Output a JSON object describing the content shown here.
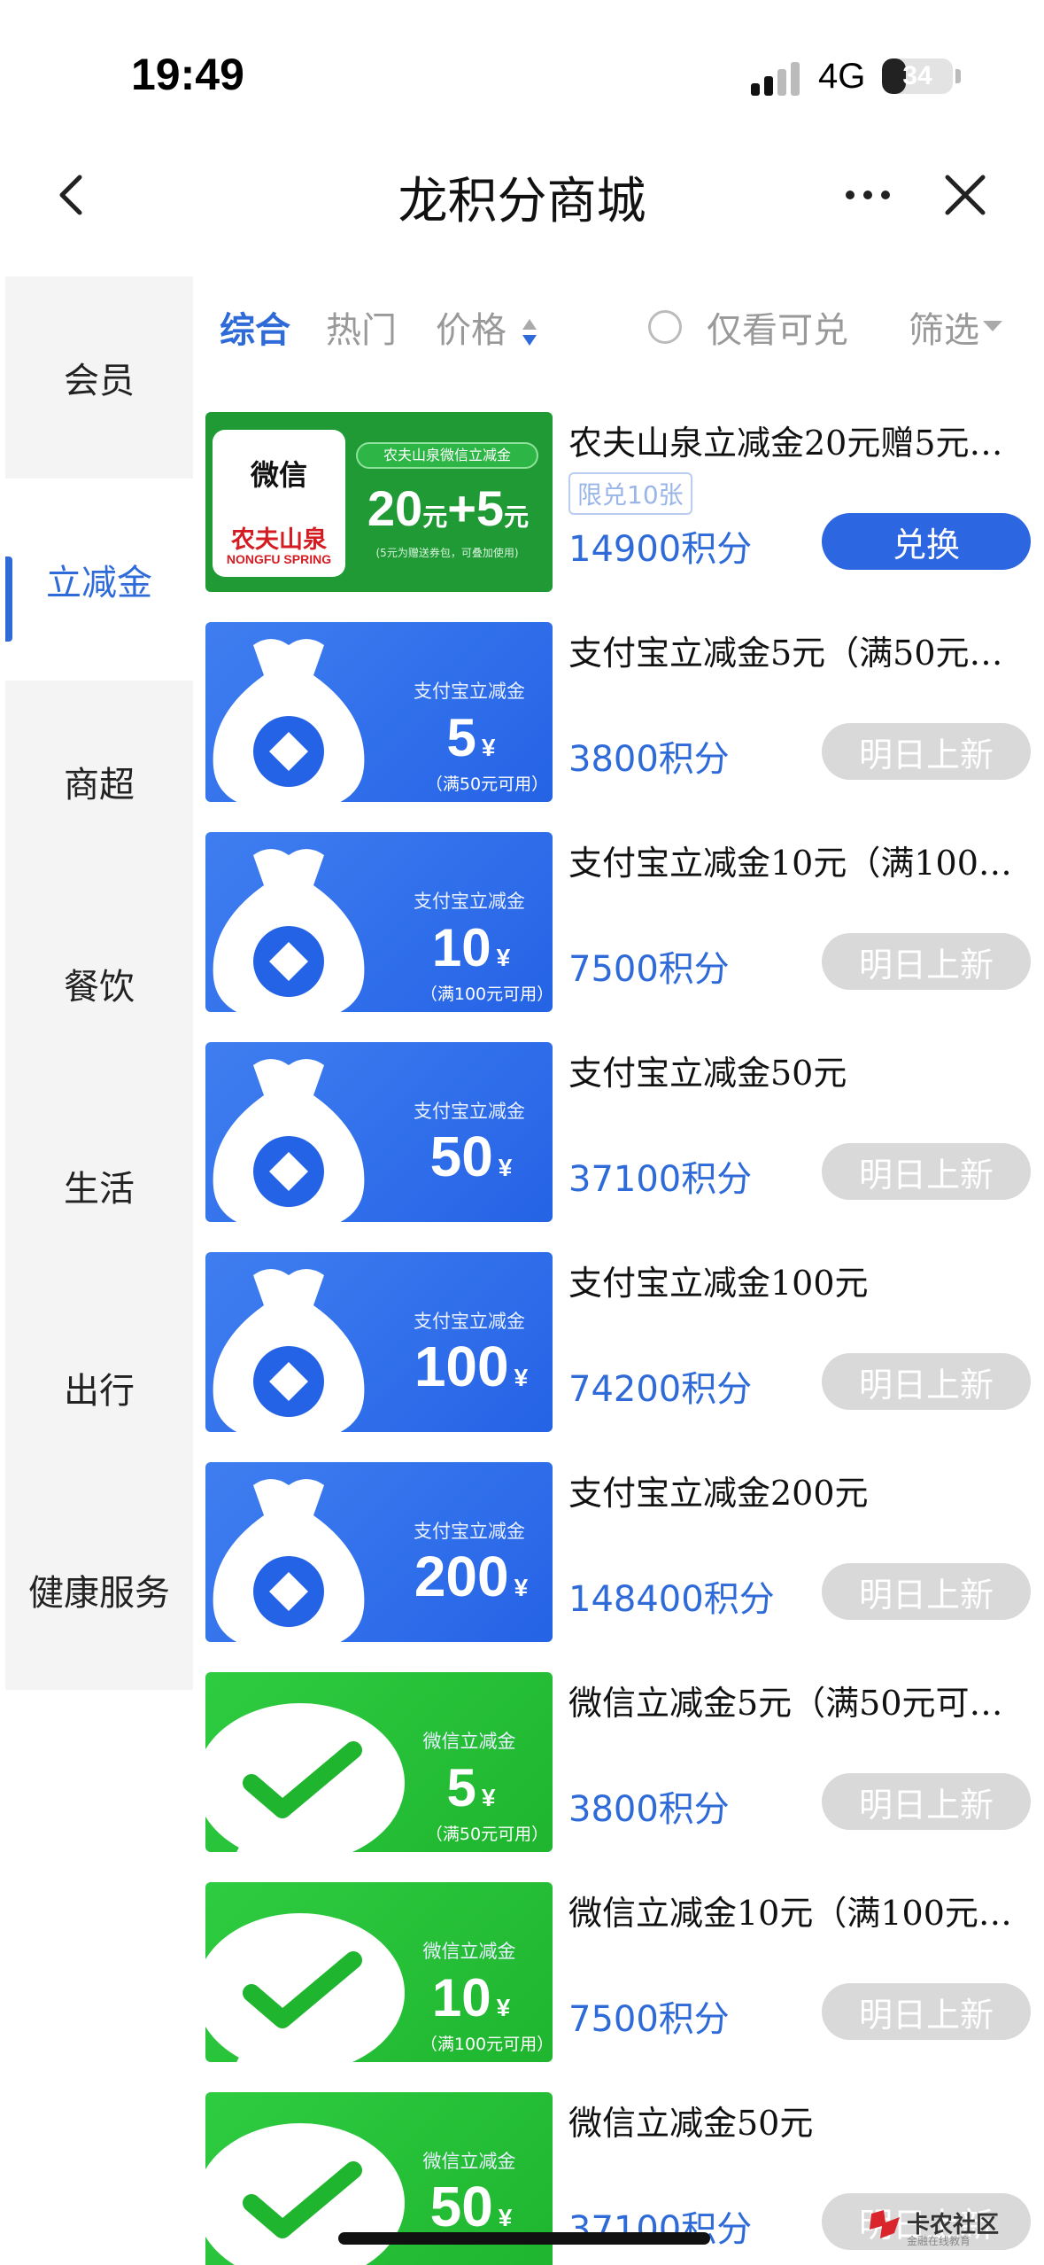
{
  "status_bar": {
    "time": "19:49",
    "network": "4G",
    "battery_level": "34",
    "battery_fraction": 0.34
  },
  "nav": {
    "title": "龙积分商城",
    "back_icon": "chevron-left-icon",
    "more_icon": "more-dots-icon",
    "close_icon": "close-icon"
  },
  "sidebar": {
    "items": [
      {
        "label": "会员"
      },
      {
        "label": "立减金"
      },
      {
        "label": "商超"
      },
      {
        "label": "餐饮"
      },
      {
        "label": "生活"
      },
      {
        "label": "出行"
      },
      {
        "label": "健康服务"
      }
    ],
    "active_index": 1,
    "accent": "#2f6bd8"
  },
  "filters": {
    "comprehensive": "综合",
    "hot": "热门",
    "price": "价格",
    "only_available": "仅看可兑",
    "filter": "筛选"
  },
  "items": [
    {
      "title": "农夫山泉立减金20元赠5元…",
      "limit": "限兑10张",
      "price": "14900积分",
      "button": "兑换",
      "thumb": {
        "type": "nongfu",
        "wx": "微信",
        "brand": "农夫山泉",
        "brand_en": "NONGFU SPRING",
        "banner": "农夫山泉微信立减金",
        "amount_a": "20",
        "unit_a": "元",
        "plus": "+",
        "amount_b": "5",
        "unit_b": "元",
        "note": "(5元为赠送券包，可叠加使用)"
      }
    },
    {
      "title": "支付宝立减金5元（满50元…",
      "price": "3800积分",
      "button": "明日上新",
      "thumb": {
        "type": "blue",
        "label": "支付宝立减金",
        "amount": "5",
        "yen": "¥",
        "cond": "（满50元可用）"
      }
    },
    {
      "title": "支付宝立减金10元（满100…",
      "price": "7500积分",
      "button": "明日上新",
      "thumb": {
        "type": "blue",
        "label": "支付宝立减金",
        "amount": "10",
        "yen": "¥",
        "cond": "（满100元可用）"
      }
    },
    {
      "title": "支付宝立减金50元",
      "price": "37100积分",
      "button": "明日上新",
      "thumb": {
        "type": "blue",
        "label": "支付宝立减金",
        "amount": "50",
        "yen": "¥",
        "cond": ""
      }
    },
    {
      "title": "支付宝立减金100元",
      "price": "74200积分",
      "button": "明日上新",
      "thumb": {
        "type": "blue",
        "label": "支付宝立减金",
        "amount": "100",
        "yen": "¥",
        "cond": ""
      }
    },
    {
      "title": "支付宝立减金200元",
      "price": "148400积分",
      "button": "明日上新",
      "thumb": {
        "type": "blue",
        "label": "支付宝立减金",
        "amount": "200",
        "yen": "¥",
        "cond": ""
      }
    },
    {
      "title": "微信立减金5元（满50元可…",
      "price": "3800积分",
      "button": "明日上新",
      "thumb": {
        "type": "green",
        "label": "微信立减金",
        "amount": "5",
        "yen": "¥",
        "cond": "（满50元可用）"
      }
    },
    {
      "title": "微信立减金10元（满100元…",
      "price": "7500积分",
      "button": "明日上新",
      "thumb": {
        "type": "green",
        "label": "微信立减金",
        "amount": "10",
        "yen": "¥",
        "cond": "（满100元可用）"
      }
    },
    {
      "title": "微信立减金50元",
      "price": "37100积分",
      "button": "明日上新",
      "thumb": {
        "type": "green",
        "label": "微信立减金",
        "amount": "50",
        "yen": "¥",
        "cond": ""
      }
    }
  ],
  "watermark": {
    "text": "卡农社区",
    "sub": "金融在线教育"
  }
}
